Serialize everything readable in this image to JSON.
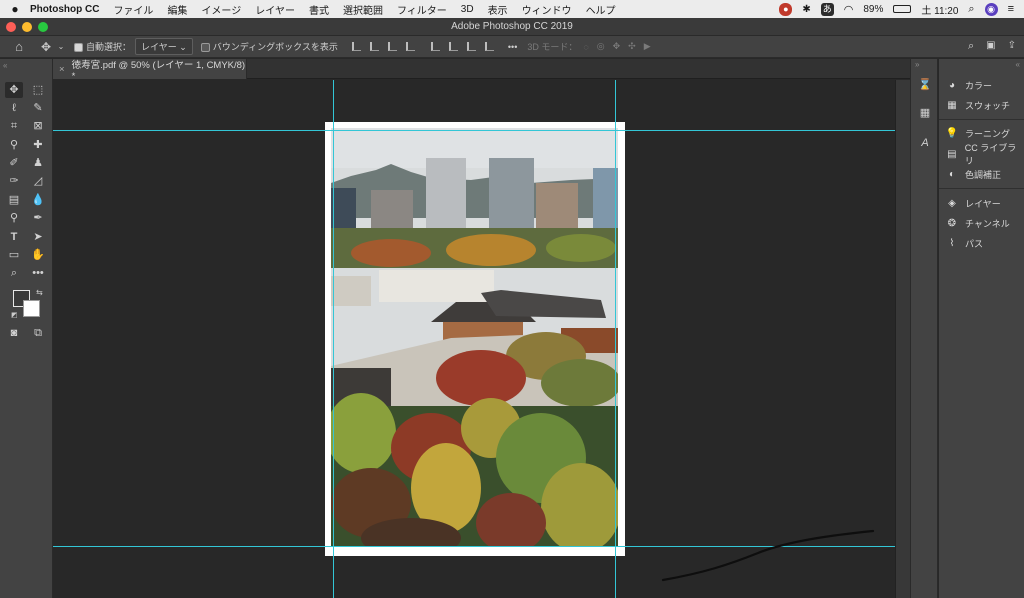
{
  "menubar": {
    "apple_icon": "apple-logo",
    "app_name": "Photoshop CC",
    "menus": [
      "ファイル",
      "編集",
      "イメージ",
      "レイヤー",
      "書式",
      "選択範囲",
      "フィルター",
      "3D",
      "表示",
      "ウィンドウ",
      "ヘルプ"
    ],
    "input_method": "あ",
    "battery": "89%",
    "clock": "土 11:20"
  },
  "window": {
    "title": "Adobe Photoshop CC 2019",
    "traffic_colors": [
      "#fe5f57",
      "#febc2e",
      "#28c840"
    ]
  },
  "options_bar": {
    "auto_select_label": "自動選択：",
    "auto_select_checked": true,
    "layer_dropdown": "レイヤー",
    "bounding_box_label": "バウンディングボックスを表示",
    "bounding_box_checked": false,
    "mode_3d_label": "3D モード：",
    "more": "•••"
  },
  "document_tab": {
    "close": "×",
    "label": "徳寿宮.pdf @ 50% (レイヤー 1, CMYK/8) *"
  },
  "tools": {
    "type_tool": "T",
    "more_tools": "•••"
  },
  "panels": {
    "group1": [
      "カラー",
      "スウォッチ"
    ],
    "group2": [
      "ラーニング",
      "CC ライブラリ",
      "色調補正"
    ],
    "group3": [
      "レイヤー",
      "チャンネル",
      "パス"
    ]
  },
  "colors": {
    "guide": "#33c6d6",
    "foreground": "#3a3a3a",
    "background": "#ffffff",
    "ui_panel": "#434343",
    "canvas": "#282828"
  }
}
